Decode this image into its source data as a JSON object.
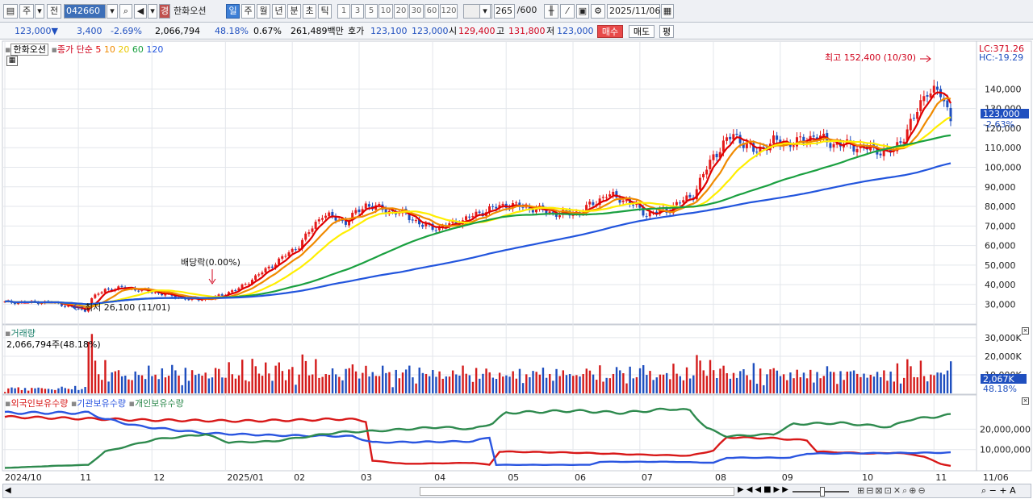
{
  "toolbar": {
    "market_type": "주",
    "prefix": "전",
    "stock_code": "042660",
    "stock_badge": "경",
    "stock_name": "한화오션",
    "periods": [
      "일",
      "주",
      "월",
      "년",
      "분",
      "초",
      "틱"
    ],
    "selected_period": "일",
    "intervals": [
      "1",
      "3",
      "5",
      "10",
      "20",
      "30",
      "60",
      "120"
    ],
    "bar_count": "265",
    "bar_max": "/600",
    "date": "2025/11/06"
  },
  "info": {
    "price": "123,000",
    "change": "3,400",
    "change_pct": "-2.69%",
    "volume": "2,066,794",
    "volume_ratio": "48.18%",
    "turnover": "0.67%",
    "trade_value": "261,489백만",
    "quote_label": "호가",
    "bid": "123,100",
    "ask": "123,000",
    "open_label": "시",
    "open": "129,400",
    "high_label": "고",
    "high": "131,800",
    "low_label": "저",
    "low": "123,000",
    "buy_btn": "매수",
    "sell_btn": "매도",
    "avg_btn": "평"
  },
  "price_panel": {
    "stock_name": "한화오션",
    "ma_label": "종가 단순",
    "ma_periods": [
      "5",
      "10",
      "20",
      "60",
      "120"
    ],
    "ma_colors": [
      "#e00000",
      "#f08a00",
      "#ffee00",
      "#1aa040",
      "#2255dd"
    ],
    "lc": "LC:371.26",
    "hc": "HC:-19.29",
    "current_price": "123,000",
    "current_pct": "-2.63%",
    "high_annot": "최고 152,400 (10/30)",
    "low_annot": "최저 26,100 (11/01)",
    "dividend_annot": "배당락(0.00%)",
    "y_ticks": [
      "140,000",
      "130,000",
      "120,000",
      "110,000",
      "100,000",
      "90,000",
      "80,000",
      "70,000",
      "60,000",
      "50,000",
      "40,000",
      "30,000"
    ]
  },
  "volume_panel": {
    "title": "거래량",
    "value": "2,066,794주(48.18%)",
    "y_ticks": [
      "30,000K",
      "20,000K",
      "10,000K"
    ],
    "current": "2,067K",
    "current_pct": "48.18%"
  },
  "holding_panel": {
    "series_names": [
      "외국인보유수량",
      "기관보유수량",
      "개인보유수량"
    ],
    "series_colors": [
      "#d81818",
      "#2a55e0",
      "#2e8a4e"
    ],
    "y_ticks": [
      "20,000,000",
      "10,000,000"
    ]
  },
  "x_axis": {
    "labels": [
      "2024/10",
      "11",
      "12",
      "2025/01",
      "02",
      "03",
      "04",
      "05",
      "06",
      "07",
      "08",
      "09",
      "10",
      "11"
    ],
    "end_date": "11/06"
  },
  "chart_data": {
    "type": "candlestick",
    "price_anchors": [
      [
        0,
        31000
      ],
      [
        14,
        31000
      ],
      [
        20,
        28500
      ],
      [
        24,
        26500
      ],
      [
        26,
        33000
      ],
      [
        30,
        37500
      ],
      [
        36,
        38500
      ],
      [
        45,
        36000
      ],
      [
        55,
        32500
      ],
      [
        62,
        33000
      ],
      [
        70,
        38000
      ],
      [
        80,
        50000
      ],
      [
        88,
        60000
      ],
      [
        95,
        76000
      ],
      [
        102,
        72000
      ],
      [
        108,
        81000
      ],
      [
        114,
        78000
      ],
      [
        120,
        76000
      ],
      [
        125,
        70000
      ],
      [
        130,
        69000
      ],
      [
        137,
        73000
      ],
      [
        144,
        78000
      ],
      [
        150,
        81000
      ],
      [
        158,
        79000
      ],
      [
        166,
        76000
      ],
      [
        172,
        77000
      ],
      [
        180,
        86000
      ],
      [
        186,
        83000
      ],
      [
        192,
        76000
      ],
      [
        198,
        78000
      ],
      [
        206,
        86000
      ],
      [
        212,
        106000
      ],
      [
        218,
        117000
      ],
      [
        224,
        108000
      ],
      [
        230,
        113000
      ],
      [
        236,
        112000
      ],
      [
        242,
        116000
      ],
      [
        248,
        112000
      ],
      [
        254,
        111000
      ],
      [
        260,
        109000
      ],
      [
        266,
        108000
      ],
      [
        272,
        125000
      ],
      [
        276,
        140000
      ],
      [
        280,
        137000
      ],
      [
        283,
        126000
      ]
    ],
    "holding": {
      "foreign": [
        [
          0,
          26000000
        ],
        [
          28,
          25000000
        ],
        [
          40,
          24500000
        ],
        [
          70,
          24000000
        ],
        [
          90,
          24500000
        ],
        [
          102,
          25000000
        ],
        [
          108,
          24000000
        ],
        [
          110,
          4500000
        ],
        [
          120,
          3000000
        ],
        [
          140,
          3500000
        ],
        [
          145,
          2500000
        ],
        [
          148,
          9000000
        ],
        [
          170,
          8500000
        ],
        [
          190,
          7500000
        ],
        [
          205,
          7000000
        ],
        [
          212,
          9500000
        ],
        [
          216,
          16000000
        ],
        [
          230,
          15500000
        ],
        [
          240,
          14500000
        ],
        [
          243,
          9000000
        ],
        [
          260,
          8000000
        ],
        [
          266,
          8500000
        ],
        [
          272,
          7500000
        ],
        [
          275,
          6500000
        ],
        [
          280,
          3000000
        ],
        [
          283,
          2000000
        ]
      ],
      "institution": [
        [
          0,
          28000000
        ],
        [
          25,
          28000000
        ],
        [
          30,
          25000000
        ],
        [
          40,
          21500000
        ],
        [
          60,
          18000000
        ],
        [
          80,
          17000000
        ],
        [
          104,
          16500000
        ],
        [
          110,
          13500000
        ],
        [
          140,
          14000000
        ],
        [
          145,
          16000000
        ],
        [
          147,
          2500000
        ],
        [
          175,
          2500000
        ],
        [
          178,
          4000000
        ],
        [
          200,
          4000000
        ],
        [
          212,
          3500000
        ],
        [
          216,
          6000000
        ],
        [
          235,
          6000000
        ],
        [
          240,
          8000000
        ],
        [
          283,
          8500000
        ]
      ],
      "individual": [
        [
          0,
          1000000
        ],
        [
          15,
          2000000
        ],
        [
          25,
          2500000
        ],
        [
          30,
          9000000
        ],
        [
          45,
          15000000
        ],
        [
          60,
          17500000
        ],
        [
          67,
          13500000
        ],
        [
          80,
          14000000
        ],
        [
          100,
          18500000
        ],
        [
          110,
          19000000
        ],
        [
          130,
          21000000
        ],
        [
          140,
          20000000
        ],
        [
          146,
          23000000
        ],
        [
          150,
          28000000
        ],
        [
          170,
          29000000
        ],
        [
          185,
          28000000
        ],
        [
          200,
          30000000
        ],
        [
          205,
          29000000
        ],
        [
          210,
          20500000
        ],
        [
          216,
          16500000
        ],
        [
          230,
          17500000
        ],
        [
          236,
          22500000
        ],
        [
          250,
          23000000
        ],
        [
          265,
          21000000
        ],
        [
          270,
          24500000
        ],
        [
          283,
          27000000
        ]
      ]
    },
    "y_price_range": [
      24000,
      155000
    ],
    "y_volume_range": [
      0,
      33000000
    ],
    "y_holding_range": [
      0,
      32000000
    ]
  }
}
